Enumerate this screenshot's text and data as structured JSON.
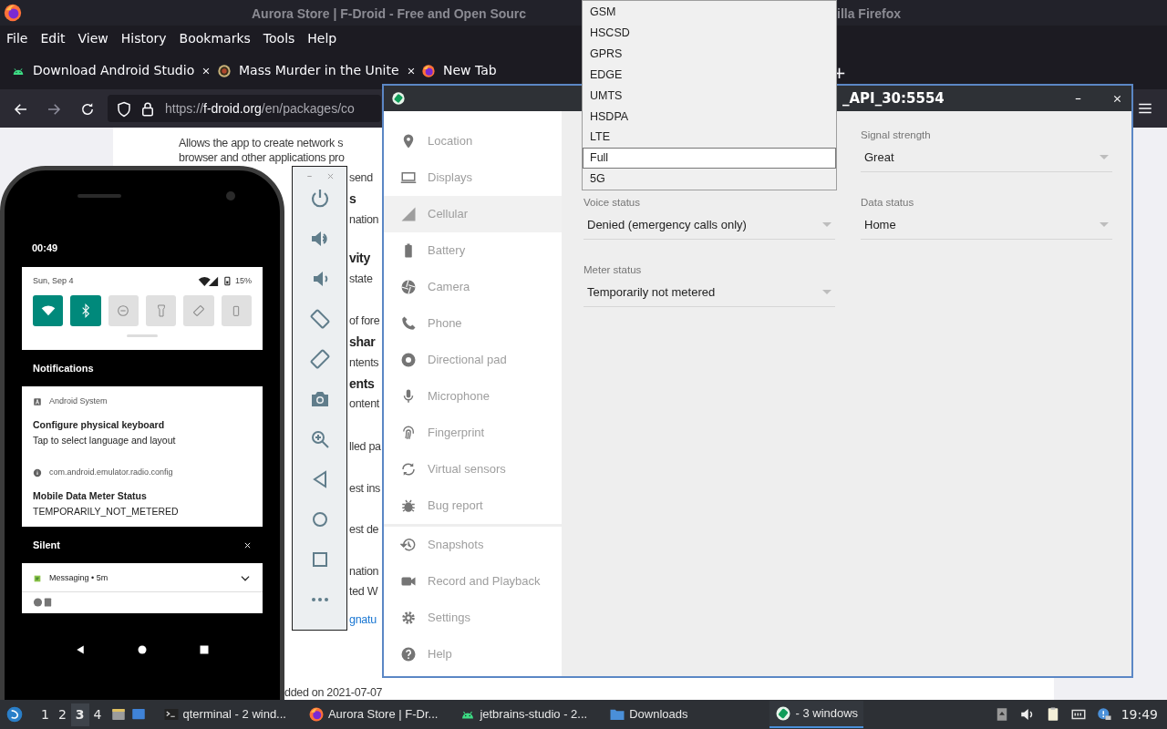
{
  "firefox": {
    "title_parts": [
      "Aurora Store | F-Droid - Free and Open Sourc",
      "illa Firefox"
    ],
    "menu": [
      "File",
      "Edit",
      "View",
      "History",
      "Bookmarks",
      "Tools",
      "Help"
    ],
    "tabs": [
      {
        "label": "Download Android Studio",
        "selected": false
      },
      {
        "label": "Mass Murder in the Unite",
        "selected": false
      },
      {
        "label": "New Tab",
        "selected": false
      }
    ],
    "new_tab": "+",
    "url": {
      "scheme": "https://",
      "host": "f-droid.org",
      "path": "/en/packages/co"
    },
    "page_fragments": [
      {
        "text": "Allows the app to create network s",
        "kind": "text"
      },
      {
        "text": "browser and other applications pro",
        "kind": "text"
      },
      {
        "text": "send",
        "kind": "text"
      },
      {
        "text": "s",
        "kind": "heading"
      },
      {
        "text": "nation",
        "kind": "text"
      },
      {
        "text": "vity",
        "kind": "heading"
      },
      {
        "text": "state",
        "kind": "text"
      },
      {
        "text": "of fore",
        "kind": "text"
      },
      {
        "text": "shar",
        "kind": "heading"
      },
      {
        "text": "ntents",
        "kind": "text"
      },
      {
        "text": "ents",
        "kind": "heading"
      },
      {
        "text": "ontent",
        "kind": "text"
      },
      {
        "text": "lled pa",
        "kind": "text"
      },
      {
        "text": "est ins",
        "kind": "text"
      },
      {
        "text": "est de",
        "kind": "text"
      },
      {
        "text": "nation",
        "kind": "text"
      },
      {
        "text": "ted W",
        "kind": "text"
      },
      {
        "text": "gnatu",
        "kind": "link"
      },
      {
        "text": "dded on 2021-07-07",
        "kind": "text"
      }
    ]
  },
  "phone": {
    "time": "00:49",
    "date": "Sun, Sep 4",
    "battery": "15%",
    "tiles": [
      {
        "kind": "wifi",
        "on": true
      },
      {
        "kind": "bluetooth",
        "on": true
      },
      {
        "kind": "dnd",
        "on": false
      },
      {
        "kind": "flashlight",
        "on": false
      },
      {
        "kind": "rotate",
        "on": false
      },
      {
        "kind": "battery",
        "on": false
      }
    ],
    "notifications_header": "Notifications",
    "notifications": [
      {
        "app": "Android System",
        "title": "Configure physical keyboard",
        "body": "Tap to select language and layout"
      },
      {
        "app": "com.android.emulator.radio.config",
        "title": "Mobile Data Meter Status",
        "body": "TEMPORARILY_NOT_METERED"
      }
    ],
    "silent_header": "Silent",
    "silent_item": "Messaging • 5m"
  },
  "extended_controls": {
    "title": "_API_30:5554",
    "sidebar": [
      {
        "label": "Location",
        "selected": false
      },
      {
        "label": "Displays",
        "selected": false
      },
      {
        "label": "Cellular",
        "selected": true
      },
      {
        "label": "Battery",
        "selected": false
      },
      {
        "label": "Camera",
        "selected": false
      },
      {
        "label": "Phone",
        "selected": false
      },
      {
        "label": "Directional pad",
        "selected": false
      },
      {
        "label": "Microphone",
        "selected": false
      },
      {
        "label": "Fingerprint",
        "selected": false
      },
      {
        "label": "Virtual sensors",
        "selected": false
      },
      {
        "label": "Bug report",
        "selected": false
      }
    ],
    "sidebar_bottom": [
      {
        "label": "Snapshots",
        "selected": false
      },
      {
        "label": "Record and Playback",
        "selected": false
      },
      {
        "label": "Settings",
        "selected": false
      },
      {
        "label": "Help",
        "selected": false
      }
    ],
    "fields": [
      {
        "label": "Signal strength",
        "value": "Great"
      },
      {
        "label": "Voice status",
        "value": "Denied (emergency calls only)"
      },
      {
        "label": "Data status",
        "value": "Home"
      },
      {
        "label": "Meter status",
        "value": "Temporarily not metered"
      }
    ],
    "dropdown": [
      {
        "label": "GSM",
        "selected": false
      },
      {
        "label": "HSCSD",
        "selected": false
      },
      {
        "label": "GPRS",
        "selected": false
      },
      {
        "label": "EDGE",
        "selected": false
      },
      {
        "label": "UMTS",
        "selected": false
      },
      {
        "label": "HSDPA",
        "selected": false
      },
      {
        "label": "LTE",
        "selected": false
      },
      {
        "label": "Full",
        "selected": true
      },
      {
        "label": "5G",
        "selected": false
      }
    ]
  },
  "taskbar": {
    "workspaces": [
      {
        "label": "1",
        "selected": false
      },
      {
        "label": "2",
        "selected": false
      },
      {
        "label": "3",
        "selected": true
      },
      {
        "label": "4",
        "selected": false
      }
    ],
    "tasks": [
      {
        "label": "qterminal - 2 wind...",
        "selected": false
      },
      {
        "label": "Aurora Store | F-Dr...",
        "selected": false
      },
      {
        "label": "jetbrains-studio - 2...",
        "selected": false
      },
      {
        "label": "Downloads",
        "selected": false
      },
      {
        "label": "- 3 windows",
        "selected": true
      }
    ],
    "clock": "19:49"
  }
}
